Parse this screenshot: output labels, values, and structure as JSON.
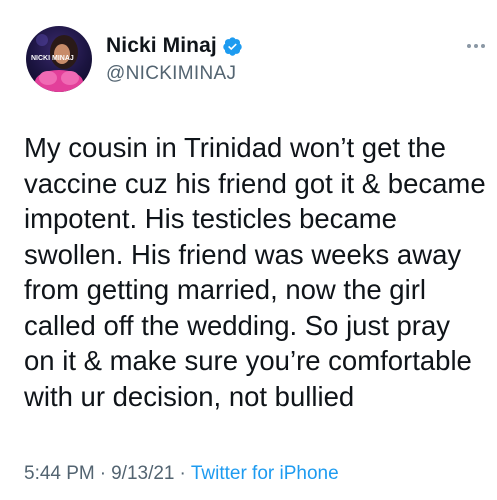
{
  "author": {
    "display_name": "Nicki Minaj",
    "handle": "@NICKIMINAJ",
    "verified": true,
    "avatar_icon": "profile-photo-icon",
    "avatar_text": "NICKI MINAJ"
  },
  "tweet": {
    "text_lines": [
      "My cousin in Trinidad won’t get the",
      "vaccine cuz his friend got it & became",
      "impotent. His testicles became",
      "swollen. His friend was weeks away",
      "from getting married, now the girl",
      "called off the wedding. So just pray",
      "on it & make sure you’re comfortable",
      "with ur decision, not bullied"
    ],
    "time": "5:44 PM",
    "date": "9/13/21",
    "separator": "·",
    "source": "Twitter for iPhone"
  },
  "colors": {
    "accent": "#1d9bf0",
    "secondary_text": "#536471",
    "primary_text": "#0f1419"
  }
}
